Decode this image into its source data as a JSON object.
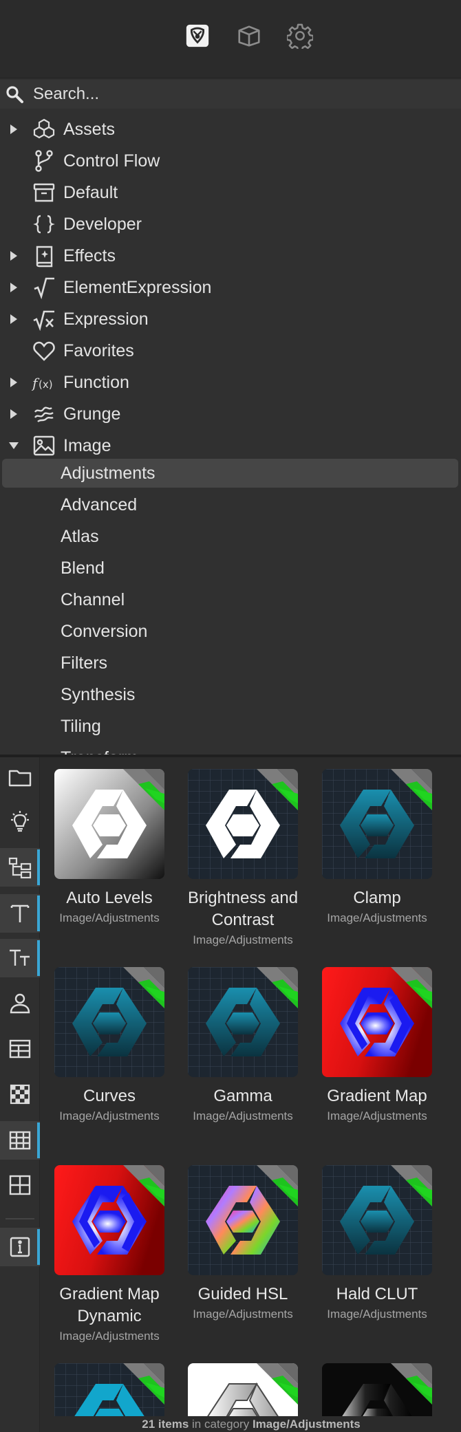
{
  "toolbar": {
    "buttons": [
      {
        "name": "node-library",
        "icon": "logo-icon"
      },
      {
        "name": "packages",
        "icon": "box-icon"
      },
      {
        "name": "settings",
        "icon": "gear-icon"
      }
    ]
  },
  "search": {
    "placeholder": "Search..."
  },
  "tree": {
    "items": [
      {
        "label": "Assets",
        "icon": "cubes-icon",
        "expandable": true
      },
      {
        "label": "Control Flow",
        "icon": "branch-icon",
        "expandable": false
      },
      {
        "label": "Default",
        "icon": "archive-icon",
        "expandable": false
      },
      {
        "label": "Developer",
        "icon": "braces-icon",
        "expandable": false
      },
      {
        "label": "Effects",
        "icon": "sparkle-book-icon",
        "expandable": true
      },
      {
        "label": "ElementExpression",
        "icon": "sqrt-icon",
        "expandable": true
      },
      {
        "label": "Expression",
        "icon": "sqrt-x-icon",
        "expandable": true
      },
      {
        "label": "Favorites",
        "icon": "heart-icon",
        "expandable": false
      },
      {
        "label": "Function",
        "icon": "function-icon",
        "expandable": true
      },
      {
        "label": "Grunge",
        "icon": "grunge-icon",
        "expandable": true
      },
      {
        "label": "Image",
        "icon": "image-icon",
        "expandable": true,
        "expanded": true
      }
    ],
    "subitems": [
      "Adjustments",
      "Advanced",
      "Atlas",
      "Blend",
      "Channel",
      "Conversion",
      "Filters",
      "Synthesis",
      "Tiling",
      "Transform"
    ],
    "selected": "Adjustments"
  },
  "sidebar": [
    {
      "name": "folder",
      "icon": "folder-icon",
      "active": false
    },
    {
      "name": "hints",
      "icon": "lightbulb-icon",
      "active": false
    },
    {
      "name": "node-tree",
      "icon": "tree-icon",
      "active": true
    },
    {
      "name": "text",
      "icon": "text-icon",
      "active": true
    },
    {
      "name": "text-size",
      "icon": "text-size-icon",
      "active": true
    },
    {
      "name": "user",
      "icon": "person-icon",
      "active": false
    },
    {
      "name": "table",
      "icon": "table-icon",
      "active": false
    },
    {
      "name": "checker",
      "icon": "checkerboard-icon",
      "active": false
    },
    {
      "name": "grid",
      "icon": "grid-icon",
      "active": true
    },
    {
      "name": "grid-2",
      "icon": "grid-2x2-icon",
      "active": false
    },
    {
      "name": "info",
      "icon": "info-icon",
      "active": true
    }
  ],
  "nodes": [
    {
      "name": "Auto Levels",
      "category": "Image/Adjustments",
      "style": "white-gray"
    },
    {
      "name": "Brightness and Contrast",
      "category": "Image/Adjustments",
      "style": "white-dark"
    },
    {
      "name": "Clamp",
      "category": "Image/Adjustments",
      "style": "teal"
    },
    {
      "name": "Curves",
      "category": "Image/Adjustments",
      "style": "teal"
    },
    {
      "name": "Gamma",
      "category": "Image/Adjustments",
      "style": "teal"
    },
    {
      "name": "Gradient Map",
      "category": "Image/Adjustments",
      "style": "red-blue"
    },
    {
      "name": "Gradient Map Dynamic",
      "category": "Image/Adjustments",
      "style": "red-blue"
    },
    {
      "name": "Guided HSL",
      "category": "Image/Adjustments",
      "style": "rainbow"
    },
    {
      "name": "Hald CLUT",
      "category": "Image/Adjustments",
      "style": "teal"
    },
    {
      "name": "",
      "category": "",
      "style": "cyan"
    },
    {
      "name": "",
      "category": "",
      "style": "white-light"
    },
    {
      "name": "",
      "category": "",
      "style": "black"
    }
  ],
  "status": {
    "count": "21 items",
    "middle": "in category",
    "category": "Image/Adjustments"
  },
  "colors": {
    "accent": "#3aa7d6",
    "badge_green": "#1ec31e",
    "badge_gray": "#7a7a7a"
  }
}
